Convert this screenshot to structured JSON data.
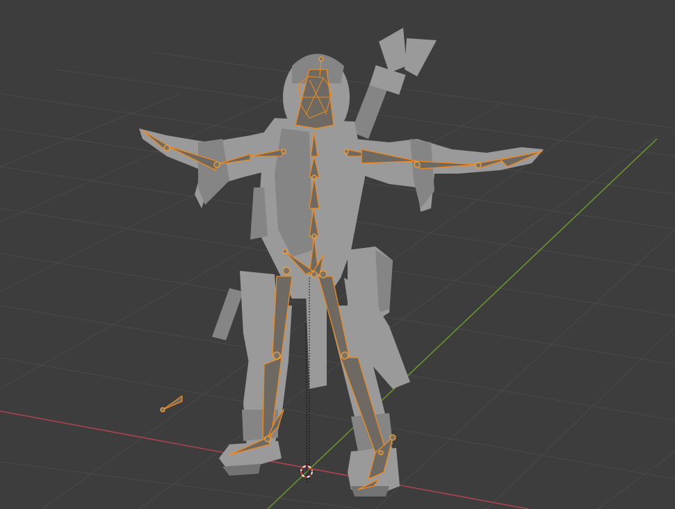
{
  "viewport": {
    "background_color": "#3d3d3d",
    "grid_color": "#4a4a4a",
    "x_axis_color": "#b0444f",
    "y_axis_color": "#6a9a2a",
    "armature_color": "#f08a1c",
    "mesh_color": "#9a9a9a"
  },
  "scene": {
    "object_mesh": "character-mesh",
    "armature": "character-armature",
    "cursor_icon": "3d-cursor-icon"
  }
}
